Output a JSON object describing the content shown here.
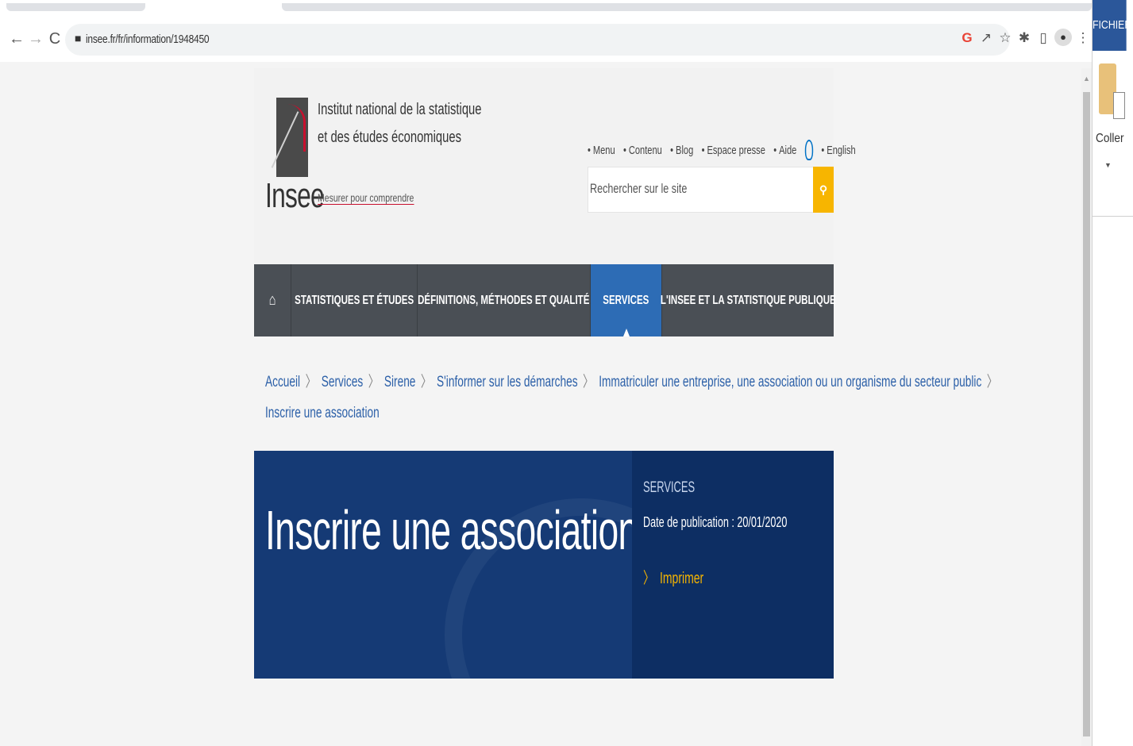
{
  "browser": {
    "url": "insee.fr/fr/information/1948450",
    "back_icon": "←",
    "forward_icon": "→",
    "reload_icon": "C",
    "toolbar_icons": [
      "google-icon",
      "share-icon",
      "star-icon",
      "extensions-icon",
      "sidebar-icon",
      "profile-icon",
      "menu-icon"
    ]
  },
  "office_panel": {
    "tab_label": "FICHIER",
    "paste_label": "Coller"
  },
  "header": {
    "institute_line1": "Institut national de la statistique",
    "institute_line2": "et des études économiques",
    "logo_word": "Insee",
    "tagline": "Mesurer pour comprendre",
    "top_links": {
      "menu": "Menu",
      "contenu": "Contenu",
      "blog": "Blog",
      "presse": "Espace presse",
      "aide": "Aide",
      "english": "English"
    },
    "search_placeholder": "Rechercher sur le site"
  },
  "nav": {
    "home_icon": "⌂",
    "stats": "STATISTIQUES ET ÉTUDES",
    "definitions": "DÉFINITIONS, MÉTHODES ET QUALITÉ",
    "services": "SERVICES",
    "insee_public": "L'INSEE ET LA STATISTIQUE PUBLIQUE"
  },
  "breadcrumb": {
    "accueil": "Accueil",
    "services": "Services",
    "sirene": "Sirene",
    "informer": "S'informer sur les démarches",
    "immatriculer": "Immatriculer une entreprise, une association ou un organisme du secteur public",
    "current": "Inscrire une association"
  },
  "hero": {
    "title": "Inscrire une association",
    "category": "SERVICES",
    "date": "Date de publication : 20/01/2020",
    "print": "Imprimer"
  },
  "colors": {
    "hero_bg": "#153a75",
    "nav_bg": "#4a4f55",
    "nav_active": "#2d6cb5",
    "accent_yellow": "#f7b500",
    "link_blue": "#2c60a8"
  }
}
